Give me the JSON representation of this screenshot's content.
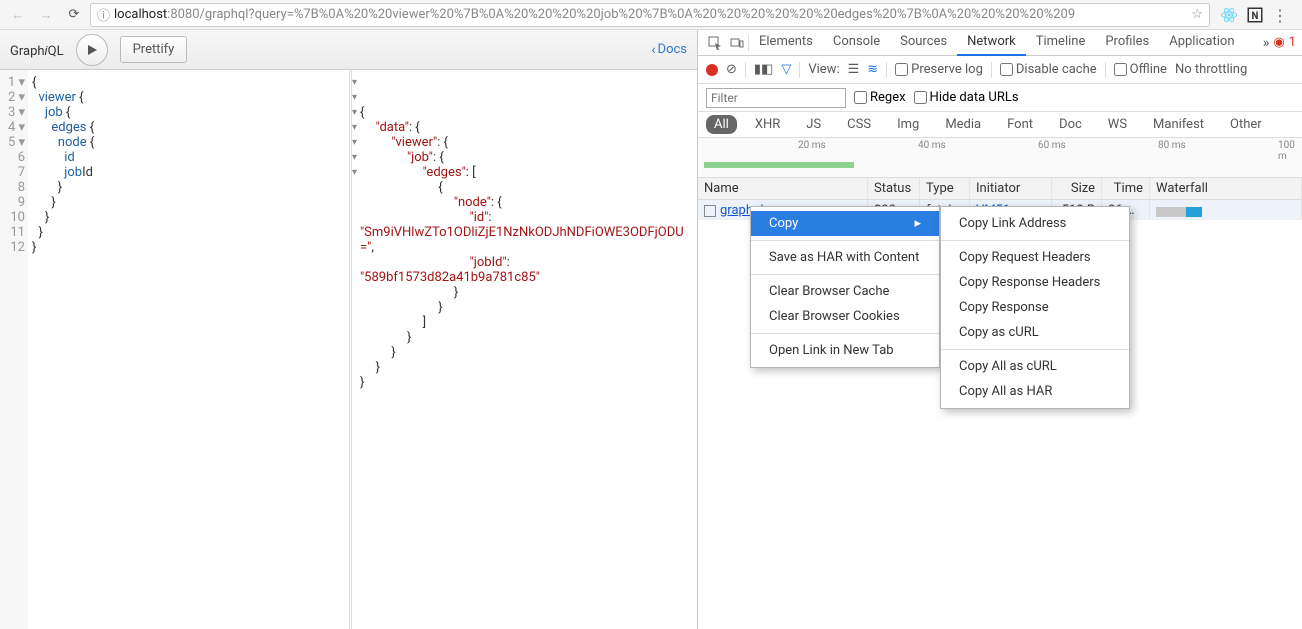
{
  "url": {
    "prefix_icon": "ⓘ",
    "host": "localhost",
    "path": ":8080/graphql?query=%7B%0A%20%20viewer%20%7B%0A%20%20%20%20job%20%7B%0A%20%20%20%20%20%20edges%20%7B%0A%20%20%20%20%209"
  },
  "graphiql": {
    "logo_pre": "Graph",
    "logo_i": "i",
    "logo_post": "QL",
    "prettify": "Prettify",
    "docs": "Docs",
    "query_lines": [
      "{",
      "  viewer {",
      "    job {",
      "      edges {",
      "        node {",
      "          id",
      "          jobId",
      "        }",
      "      }",
      "    }",
      "  }",
      "}"
    ],
    "result": {
      "data": "data",
      "viewer": "viewer",
      "job": "job",
      "edges": "edges",
      "node": "node",
      "id": "id",
      "id_val": "Sm9iVHlwZTo1ODliZjE1NzNkODJhNDFiOWE3ODFjODU=",
      "jobId": "jobId",
      "jobId_val": "589bf1573d82a41b9a781c85"
    }
  },
  "devtools": {
    "tabs": [
      "Elements",
      "Console",
      "Sources",
      "Network",
      "Timeline",
      "Profiles",
      "Application"
    ],
    "active_tab": "Network",
    "err_count": "1",
    "toolbar": {
      "view": "View:",
      "preserve": "Preserve log",
      "disable": "Disable cache",
      "offline": "Offline",
      "throttle": "No throttling"
    },
    "filter_placeholder": "Filter",
    "regex": "Regex",
    "hide_urls": "Hide data URLs",
    "types": [
      "All",
      "XHR",
      "JS",
      "CSS",
      "Img",
      "Media",
      "Font",
      "Doc",
      "WS",
      "Manifest",
      "Other"
    ],
    "timeline": [
      "20 ms",
      "40 ms",
      "60 ms",
      "80 ms",
      "100 m"
    ],
    "columns": {
      "name": "Name",
      "status": "Status",
      "type": "Type",
      "initiator": "Initiator",
      "size": "Size",
      "time": "Time",
      "waterfall": "Waterfall"
    },
    "row": {
      "name": "graphql",
      "status": "200",
      "type": "fetch",
      "initiator": "VM51 graphq...",
      "size": "512 B",
      "time": "26 ms"
    },
    "ctx1": {
      "copy": "Copy",
      "save": "Save as HAR with Content",
      "clear_cache": "Clear Browser Cache",
      "clear_cookies": "Clear Browser Cookies",
      "open": "Open Link in New Tab"
    },
    "ctx2": {
      "link": "Copy Link Address",
      "req": "Copy Request Headers",
      "resp_h": "Copy Response Headers",
      "resp": "Copy Response",
      "curl": "Copy as cURL",
      "all_curl": "Copy All as cURL",
      "all_har": "Copy All as HAR"
    }
  }
}
